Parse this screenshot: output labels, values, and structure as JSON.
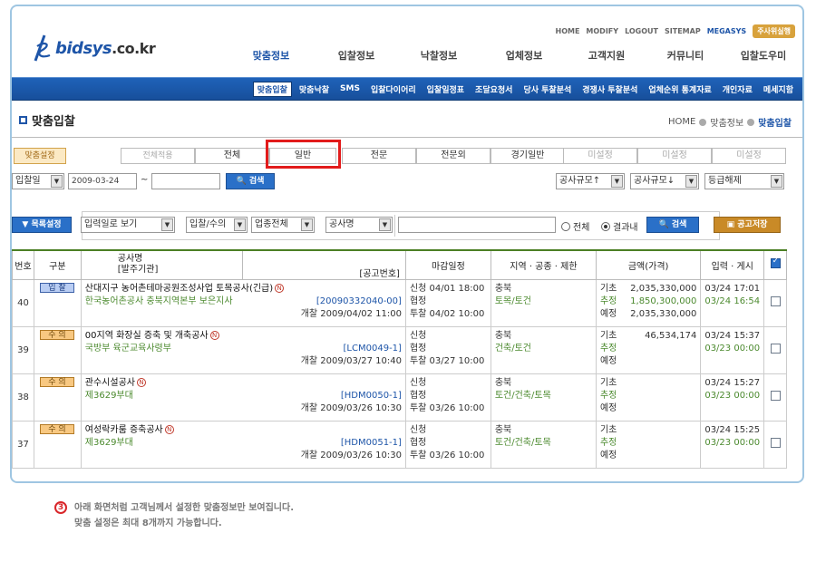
{
  "header": {
    "util_links": [
      "HOME",
      "MODIFY",
      "LOGOUT",
      "SITEMAP",
      "MEGASYS"
    ],
    "corp_badge": "주사위실행",
    "logo_text": "bidsys",
    "logo_suffix": ".co.kr",
    "gnb": [
      "맞춤정보",
      "입찰정보",
      "낙찰정보",
      "업체정보",
      "고객지원",
      "커뮤니티",
      "입찰도우미"
    ],
    "active_gnb": 0
  },
  "subnav": [
    "맞춤입찰",
    "맞춤낙찰",
    "SMS",
    "입찰다이어리",
    "입찰일정표",
    "조달요청서",
    "당사 투찰분석",
    "경쟁사 투찰분석",
    "업체순위 통계자료",
    "개인자료",
    "메세지함"
  ],
  "page": {
    "title": "맞춤입찰",
    "breadcrumb": [
      "HOME",
      "맞춤정보",
      "맞춤입찰"
    ]
  },
  "filters": {
    "setting_label": "맞춤설정",
    "all_apply": "전체적용",
    "tabs": [
      "전체",
      "일반",
      "전문",
      "전문외",
      "경기일반",
      "미설정",
      "미설정",
      "미설정"
    ]
  },
  "search_row": {
    "date_type": "입찰일",
    "date_from": "2009-03-24",
    "tilde": "~",
    "date_to": "",
    "search_label": "검색",
    "scale_up": "공사규모↑",
    "scale_down": "공사규모↓",
    "grade": "등급해제"
  },
  "filter_row": {
    "list_setting": "목록설정",
    "view_by": "입력일로 보기",
    "bid_type": "입찰/수의",
    "industry": "업종전체",
    "field": "공사명",
    "keyword": "",
    "radio_all": "전체",
    "radio_result": "결과내",
    "search_label": "검색",
    "notice_btn": "공고저장"
  },
  "table": {
    "headers": [
      "번호",
      "구분",
      "공사명",
      "[발주기관]",
      "[공고번호]",
      "마감일정",
      "지역 · 공종 · 제한",
      "금액(가격)",
      "입력 · 게시"
    ],
    "rows": [
      {
        "no": "40",
        "type": "입 찰",
        "type_kind": "ip",
        "title": "산대지구 농어촌테마공원조성사업 토목공사(긴급)",
        "org": "한국농어촌공사 충북지역본부 보은지사",
        "notice_no": "[20090332040-00]",
        "open_label": "개찰",
        "open_date": "2009/04/02 11:00",
        "sch": [
          [
            "신청",
            "04/01 18:00"
          ],
          [
            "협정",
            ""
          ],
          [
            "투찰",
            "04/02 10:00"
          ]
        ],
        "region": "충북",
        "work": "토목/토건",
        "amt": [
          [
            "기초",
            "2,035,330,000"
          ],
          [
            "추정",
            "1,850,300,000"
          ],
          [
            "예정",
            "2,035,330,000"
          ]
        ],
        "input": "03/24 17:01",
        "post": "03/24 16:54"
      },
      {
        "no": "39",
        "type": "수 의",
        "type_kind": "su",
        "title": "00지역 화장실 증축 및 개축공사",
        "org": "국방부 육군교육사령부",
        "notice_no": "[LCM0049-1]",
        "open_label": "개찰",
        "open_date": "2009/03/27 10:40",
        "sch": [
          [
            "신청",
            ""
          ],
          [
            "협정",
            ""
          ],
          [
            "투찰",
            "03/27 10:00"
          ]
        ],
        "region": "충북",
        "work": "건축/토건",
        "amt": [
          [
            "기초",
            "46,534,174"
          ],
          [
            "추정",
            ""
          ],
          [
            "예정",
            ""
          ]
        ],
        "input": "03/24 15:37",
        "post": "03/23 00:00"
      },
      {
        "no": "38",
        "type": "수 의",
        "type_kind": "su",
        "title": "관수시설공사",
        "org": "제3629부대",
        "notice_no": "[HDM0050-1]",
        "open_label": "개찰",
        "open_date": "2009/03/26 10:30",
        "sch": [
          [
            "신청",
            ""
          ],
          [
            "협정",
            ""
          ],
          [
            "투찰",
            "03/26 10:00"
          ]
        ],
        "region": "충북",
        "work": "토건/건축/토목",
        "amt": [
          [
            "기초",
            ""
          ],
          [
            "추정",
            ""
          ],
          [
            "예정",
            ""
          ]
        ],
        "input": "03/24 15:27",
        "post": "03/23 00:00"
      },
      {
        "no": "37",
        "type": "수 의",
        "type_kind": "su",
        "title": "여성락카룸 증축공사",
        "org": "제3629부대",
        "notice_no": "[HDM0051-1]",
        "open_label": "개찰",
        "open_date": "2009/03/26 10:30",
        "sch": [
          [
            "신청",
            ""
          ],
          [
            "협정",
            ""
          ],
          [
            "투찰",
            "03/26 10:00"
          ]
        ],
        "region": "충북",
        "work": "토건/건축/토목",
        "amt": [
          [
            "기초",
            ""
          ],
          [
            "추정",
            ""
          ],
          [
            "예정",
            ""
          ]
        ],
        "input": "03/24 15:25",
        "post": "03/23 00:00"
      }
    ]
  },
  "note": {
    "num": "3",
    "line1": "아래 화면처럼 고객님께서 설정한 맞춤정보만 보여집니다.",
    "line2": "맞춤 설정은 최대 8개까지 가능합니다."
  },
  "colors": {
    "brand": "#1e55a8",
    "highlight": "#e21b1b",
    "accent": "#4b7f24"
  }
}
